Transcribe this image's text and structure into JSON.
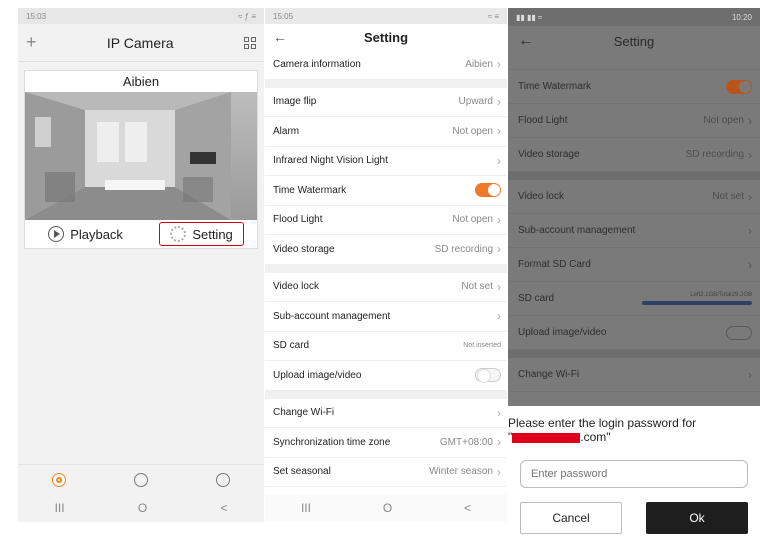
{
  "screen1": {
    "status_time": "15:03",
    "status_right": "≈ ƒ ≡",
    "plus": "+",
    "title": "IP Camera",
    "camera_name": "Aibien",
    "playback_label": "Playback",
    "setting_label": "Setting",
    "nav": [
      "III",
      "O",
      "<"
    ]
  },
  "screen2": {
    "status_time": "15:05",
    "status_right": "≈ ≡",
    "back": "←",
    "title": "Setting",
    "rows": [
      {
        "label": "Camera information",
        "value": "Aibien"
      },
      {
        "label": "Image flip",
        "value": "Upward"
      },
      {
        "label": "Alarm",
        "value": "Not open"
      },
      {
        "label": "Infrared Night Vision Light",
        "value": ""
      },
      {
        "label": "Time Watermark",
        "toggle": "on"
      },
      {
        "label": "Flood Light",
        "value": "Not open"
      },
      {
        "label": "Video storage",
        "value": "SD recording"
      },
      {
        "label": "Video lock",
        "value": "Not set"
      },
      {
        "label": "Sub-account management",
        "value": ""
      },
      {
        "label": "SD card",
        "value": "Not inserted"
      },
      {
        "label": "Upload image/video",
        "toggle": "off"
      },
      {
        "label": "Change Wi-Fi",
        "value": ""
      },
      {
        "label": "Synchronization time zone",
        "value": "GMT+08:00"
      },
      {
        "label": "Set seasonal",
        "value": "Winter season"
      }
    ],
    "nav": [
      "III",
      "O",
      "<"
    ]
  },
  "screen3": {
    "status_right": "10:20",
    "back": "←",
    "title": "Setting",
    "rows": [
      {
        "label": "Time Watermark",
        "toggle": "on"
      },
      {
        "label": "Flood Light",
        "value": "Not open"
      },
      {
        "label": "Video storage",
        "value": "SD recording"
      },
      {
        "label": "Video lock",
        "value": "Not set"
      },
      {
        "label": "Sub-account management",
        "value": ""
      },
      {
        "label": "Format SD Card",
        "value": ""
      },
      {
        "label": "SD card",
        "value": "Left2.1GB/Total29.2GB"
      },
      {
        "label": "Upload image/video",
        "toggle": "off"
      },
      {
        "label": "Change Wi-Fi",
        "value": ""
      }
    ],
    "dialog": {
      "message_prefix": "Please enter the login password for",
      "message_suffix": ".com\"",
      "quote": "\"",
      "placeholder": "Enter password",
      "cancel": "Cancel",
      "ok": "Ok"
    }
  },
  "colors": {
    "accent_orange": "#f07a2a",
    "highlight_red": "#d0021b",
    "ok_button": "#1e1e1e"
  }
}
